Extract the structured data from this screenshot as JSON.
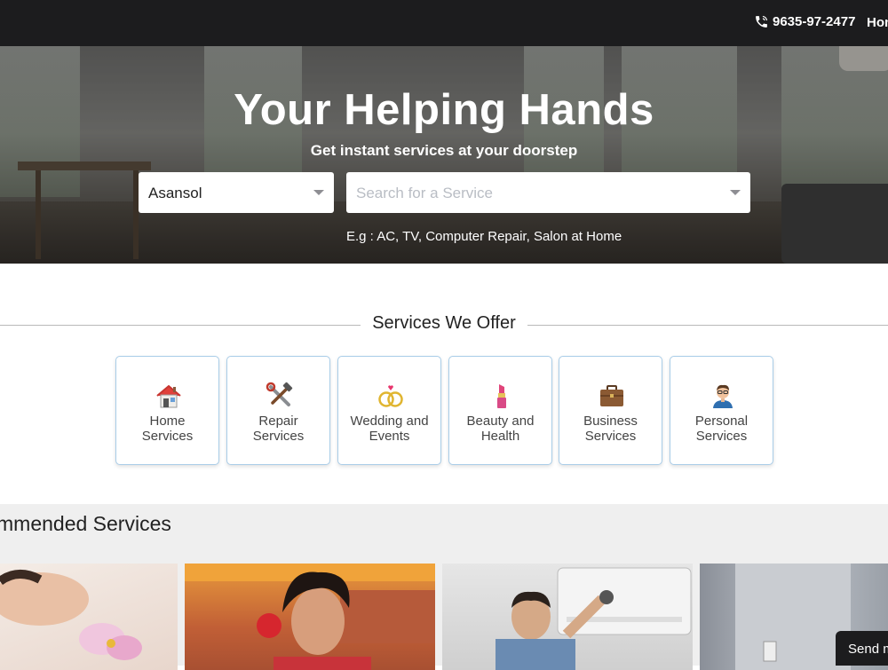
{
  "header": {
    "phone": "9635-97-2477",
    "nav_home": "Hom"
  },
  "hero": {
    "title": "Your Helping Hands",
    "subtitle": "Get instant services at your doorstep",
    "city_value": "Asansol",
    "search_placeholder": "Search for a Service",
    "example": "E.g : AC, TV, Computer Repair, Salon at Home"
  },
  "services": {
    "title": "Services We Offer",
    "items": [
      {
        "line1": "Home",
        "line2": "Services",
        "icon": "house-icon"
      },
      {
        "line1": "Repair",
        "line2": "Services",
        "icon": "tools-icon"
      },
      {
        "line1": "Wedding and",
        "line2": "Events",
        "icon": "rings-icon"
      },
      {
        "line1": "Beauty and",
        "line2": "Health",
        "icon": "lipstick-icon"
      },
      {
        "line1": "Business",
        "line2": "Services",
        "icon": "briefcase-icon"
      },
      {
        "line1": "Personal",
        "line2": "Services",
        "icon": "person-icon"
      }
    ]
  },
  "recommended": {
    "title": "mmended Services"
  },
  "chat": {
    "send_label": "Send m"
  }
}
